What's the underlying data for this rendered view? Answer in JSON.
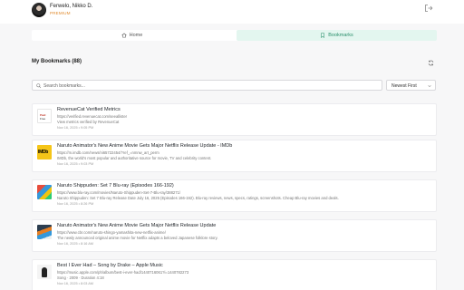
{
  "header": {
    "user_name": "Ferwelo, Nikko D.",
    "plan": "PREMIUM"
  },
  "tabs": [
    {
      "label": "Home"
    },
    {
      "label": "Bookmarks"
    }
  ],
  "section": {
    "title": "My Bookmarks (88)"
  },
  "search": {
    "placeholder": "Search bookmarks..."
  },
  "sort": {
    "selected": "Newest First"
  },
  "bookmarks": [
    {
      "thumb_line1": "Paid",
      "thumb_line2": "Free",
      "title": "RevenueCat Verified Metrics",
      "url": "https://verified.revenuecat.com/seeallister",
      "description": "View metrics verified by RevenueCat",
      "date": "Nov 16, 2025 • 9:05 PM"
    },
    {
      "thumb_text": "IMDb",
      "title": "Naruto Animator's New Anime Movie Gets Major Netflix Release Update - IMDb",
      "url": "https://m.imdb.com/news/ni65722454/?ref_=nmnw_art_perm",
      "description": "IMDb, the world's most popular and authoritative source for movie, TV and celebrity content.",
      "date": "Nov 16, 2025 • 9:03 PM"
    },
    {
      "title": "Naruto Shippuden: Set 7 Blu-ray (Episodes 166-192)",
      "url": "https://www.blu-ray.com/movies/Naruto-Shippuden-Set-7-Blu-ray/388271/",
      "description": "Naruto Shippuden: Set 7 Blu-ray Release Date July 16, 2025 (Episodes 166-192). Blu-ray reviews, news, specs, ratings, screenshots. Cheap Blu-ray movies and deals.",
      "date": "Nov 16, 2025 • 8:26 PM"
    },
    {
      "title": "Naruto Animator's New Anime Movie Gets Major Netflix Release Update",
      "url": "https://www.cbr.com/naruto-shingo-yamashita-new-netflix-anime/",
      "description": "The newly announced original anime movie for Netflix adapts a beloved Japanese folklore story.",
      "date": "Nov 16, 2025 • 8:16 AM"
    },
    {
      "title": "Best I Ever Had – Song by Drake – Apple Music",
      "url": "https://music.apple.com/ph/album/best-i-ever-had/1440716061?i=1440782273",
      "description": "Song · 2009 · Duration 4:18",
      "date": "Nov 16, 2025 • 8:03 AM"
    }
  ]
}
